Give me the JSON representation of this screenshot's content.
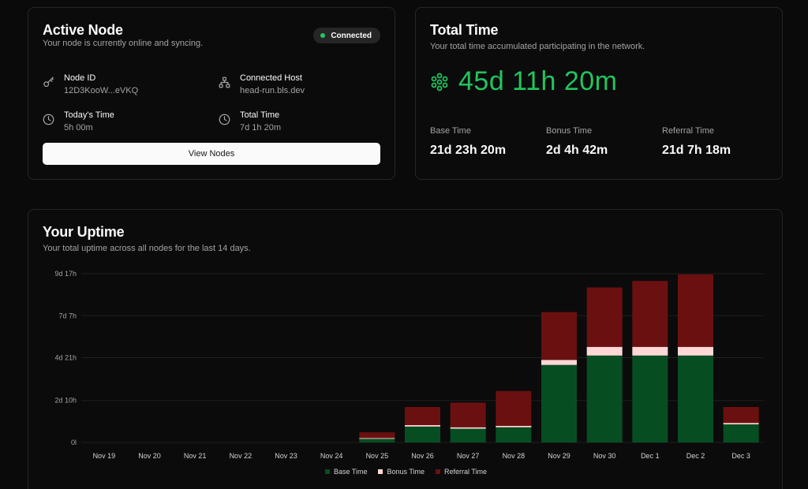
{
  "active_node": {
    "title": "Active Node",
    "subtitle": "Your node is currently online and syncing.",
    "status": "Connected",
    "node_id_label": "Node ID",
    "node_id_value": "12D3KooW...eVKQ",
    "host_label": "Connected Host",
    "host_value": "head-run.bls.dev",
    "today_label": "Today's Time",
    "today_value": "5h 00m",
    "total_label": "Total Time",
    "total_value": "7d 1h 20m",
    "button": "View Nodes"
  },
  "total_time": {
    "title": "Total Time",
    "subtitle": "Your total time accumulated participating in the network.",
    "value": "45d 11h 20m",
    "base_label": "Base Time",
    "base_value": "21d 23h 20m",
    "bonus_label": "Bonus Time",
    "bonus_value": "2d 4h 42m",
    "referral_label": "Referral Time",
    "referral_value": "21d 7h 18m"
  },
  "uptime": {
    "title": "Your Uptime",
    "subtitle": "Your total uptime across all nodes for the last 14 days."
  },
  "colors": {
    "base": "#064e21",
    "bonus": "#ffd7d7",
    "referral": "#6b1010",
    "accent": "#22c55e"
  },
  "chart_data": {
    "type": "bar",
    "stacked": true,
    "unit": "hours",
    "categories": [
      "Nov 19",
      "Nov 20",
      "Nov 21",
      "Nov 22",
      "Nov 23",
      "Nov 24",
      "Nov 25",
      "Nov 26",
      "Nov 27",
      "Nov 28",
      "Nov 29",
      "Nov 30",
      "Dec 1",
      "Dec 2",
      "Dec 3"
    ],
    "y_ticks": [
      {
        "label": "0l",
        "value": 0
      },
      {
        "label": "2d 10h",
        "value": 58
      },
      {
        "label": "4d 21h",
        "value": 117
      },
      {
        "label": "7d 7h",
        "value": 175
      },
      {
        "label": "9d 17h",
        "value": 233
      }
    ],
    "ylim": [
      0,
      233
    ],
    "series": [
      {
        "name": "Base Time",
        "values": [
          0,
          0,
          0,
          0,
          0,
          0,
          5,
          22,
          19,
          21,
          107,
          120,
          120,
          120,
          25
        ]
      },
      {
        "name": "Bonus Time",
        "values": [
          0,
          0,
          0,
          0,
          0,
          0,
          1,
          2,
          2,
          2,
          7,
          12,
          12,
          12,
          2
        ]
      },
      {
        "name": "Referral Time",
        "values": [
          0,
          0,
          0,
          0,
          0,
          0,
          8,
          25,
          34,
          48,
          66,
          82,
          91,
          100,
          22
        ]
      }
    ],
    "legend_position": "bottom",
    "grid": true
  }
}
